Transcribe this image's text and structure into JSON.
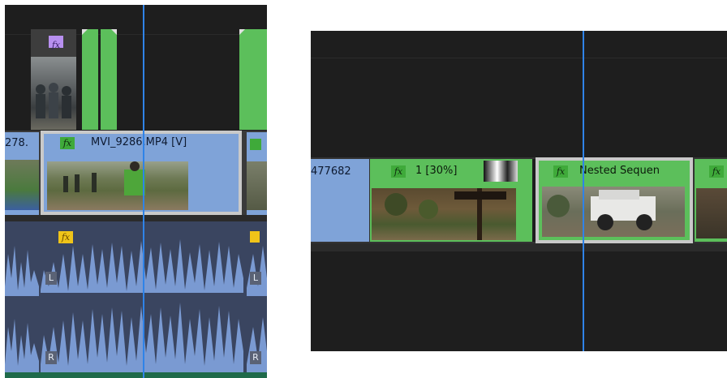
{
  "left_panel": {
    "clip_partial_label": "278.",
    "clip_main": {
      "fx": "fx",
      "name": "MVI_9286.MP4 [V]"
    },
    "top_clip_fx": "fx",
    "audio_fx": "fx",
    "channel_left": "L",
    "channel_right": "R",
    "channel_left_2": "L",
    "channel_right_2": "R"
  },
  "right_panel": {
    "clip_partial_label": "477682",
    "clip_one": {
      "fx": "fx",
      "name": "1 [30%]"
    },
    "clip_nested": {
      "fx": "fx",
      "name": "Nested Sequen"
    },
    "clip_edge_fx": "fx"
  },
  "colors": {
    "panel_bg": "#1e1e1e",
    "clip_green": "#5cbf5b",
    "clip_blue": "#7fa3d8",
    "audio_blue": "#7a9ad2",
    "playhead": "#2f83e8",
    "fx_yellow": "#f0c419",
    "fx_purple": "#b890f0"
  }
}
